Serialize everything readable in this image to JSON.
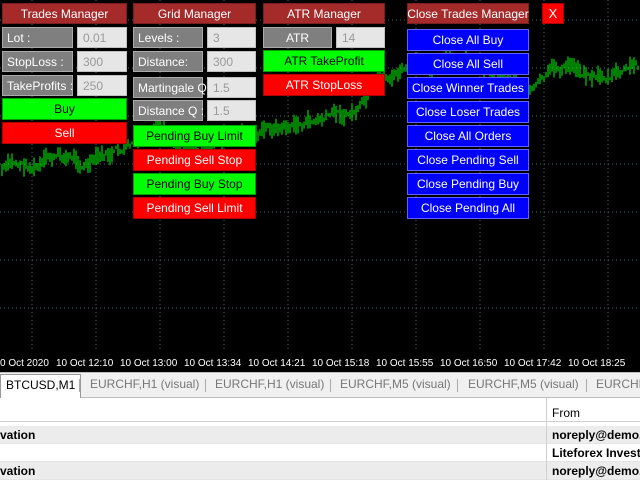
{
  "trades_manager": {
    "title": "Trades Manager",
    "lot_label": "Lot :",
    "lot_value": "0.01",
    "stoploss_label": "StopLoss :",
    "stoploss_value": "300",
    "takeprofits_label": "TakeProfits :",
    "takeprofits_value": "250",
    "buy_label": "Buy",
    "sell_label": "Sell"
  },
  "grid_manager": {
    "title": "Grid Manager",
    "levels_label": "Levels :",
    "levels_value": "3",
    "distance_label": "Distance:",
    "distance_value": "300",
    "martingale_label": "Martingale Q :",
    "martingale_value": "1.5",
    "distanceq_label": "Distance Q :",
    "distanceq_value": "1.5",
    "pending_buy_limit": "Pending Buy Limit",
    "pending_sell_stop": "Pending Sell Stop",
    "pending_buy_stop": "Pending Buy Stop",
    "pending_sell_limit": "Pending Sell Limit"
  },
  "atr_manager": {
    "title": "ATR Manager",
    "atr_label": "ATR",
    "atr_value": "14",
    "take_profit": "ATR TakeProfit",
    "stop_loss": "ATR StopLoss"
  },
  "close_manager": {
    "title": "Close Trades Manager",
    "close_symbol": "X",
    "buttons": [
      "Close All Buy",
      "Close All Sell",
      "Close Winner Trades",
      "Close Loser Trades",
      "Close All Orders",
      "Close Pending Sell",
      "Close Pending Buy",
      "Close Pending All"
    ]
  },
  "time_axis": [
    "0 Oct 2020",
    "10 Oct 12:10",
    "10 Oct 13:00",
    "10 Oct 13:34",
    "10 Oct 14:21",
    "10 Oct 15:18",
    "10 Oct 15:55",
    "10 Oct 16:50",
    "10 Oct 17:42",
    "10 Oct 18:25"
  ],
  "chart_tabs": [
    "BTCUSD,M1",
    "EURCHF,H1 (visual)",
    "EURCHF,H1 (visual)",
    "EURCHF,M5 (visual)",
    "EURCHF,M5 (visual)",
    "EURCHF"
  ],
  "mailbox": {
    "from_header": "From",
    "rows": [
      {
        "subject": "vation",
        "from": "noreply@demo."
      },
      {
        "subject": "",
        "from": "Liteforex Invest"
      },
      {
        "subject": "vation",
        "from": "noreply@demo."
      }
    ]
  },
  "colors": {
    "header": "#a52a2a",
    "buy": "#00ff00",
    "sell": "#ff0000",
    "close": "#0000ff",
    "candles": "#00ff00",
    "grid": "#4a6a7a"
  }
}
